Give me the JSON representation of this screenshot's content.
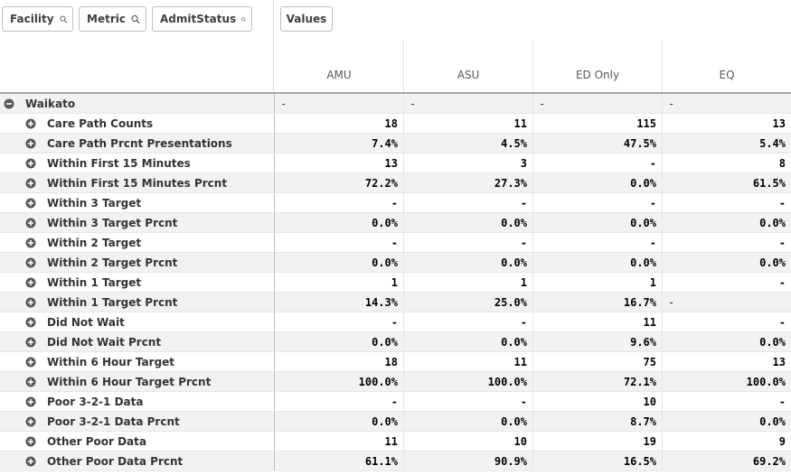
{
  "filters": [
    {
      "label": "Facility",
      "icon": "search-icon"
    },
    {
      "label": "Metric",
      "icon": "search-icon"
    },
    {
      "label": "AdmitStatus",
      "icon": "search-icon"
    }
  ],
  "values_chip": {
    "label": "Values"
  },
  "columns": [
    "AMU",
    "ASU",
    "ED Only",
    "EQ"
  ],
  "group": {
    "label": "Waikato",
    "icon": "collapse-minus-icon",
    "cells": [
      "-",
      "-",
      "-",
      "-"
    ]
  },
  "rows": [
    {
      "label": "Care Path Counts",
      "cells": [
        "18",
        "11",
        "115",
        "13"
      ]
    },
    {
      "label": "Care Path Prcnt Presentations",
      "cells": [
        "7.4%",
        "4.5%",
        "47.5%",
        "5.4%"
      ]
    },
    {
      "label": "Within First 15 Minutes",
      "cells": [
        "13",
        "3",
        "-",
        "8"
      ]
    },
    {
      "label": "Within First 15 Minutes Prcnt",
      "cells": [
        "72.2%",
        "27.3%",
        "0.0%",
        "61.5%"
      ]
    },
    {
      "label": "Within 3 Target",
      "cells": [
        "-",
        "-",
        "-",
        "-"
      ]
    },
    {
      "label": "Within 3 Target Prcnt",
      "cells": [
        "0.0%",
        "0.0%",
        "0.0%",
        "0.0%"
      ]
    },
    {
      "label": "Within 2 Target",
      "cells": [
        "-",
        "-",
        "-",
        "-"
      ]
    },
    {
      "label": "Within 2 Target Prcnt",
      "cells": [
        "0.0%",
        "0.0%",
        "0.0%",
        "0.0%"
      ]
    },
    {
      "label": "Within 1 Target",
      "cells": [
        "1",
        "1",
        "1",
        "-"
      ]
    },
    {
      "label": "Within 1 Target Prcnt",
      "cells": [
        "14.3%",
        "25.0%",
        "16.7%",
        "-"
      ]
    },
    {
      "label": "Did Not Wait",
      "cells": [
        "-",
        "-",
        "11",
        "-"
      ]
    },
    {
      "label": "Did Not Wait Prcnt",
      "cells": [
        "0.0%",
        "0.0%",
        "9.6%",
        "0.0%"
      ]
    },
    {
      "label": "Within 6 Hour Target",
      "cells": [
        "18",
        "11",
        "75",
        "13"
      ]
    },
    {
      "label": "Within 6 Hour Target Prcnt",
      "cells": [
        "100.0%",
        "100.0%",
        "72.1%",
        "100.0%"
      ]
    },
    {
      "label": "Poor 3-2-1 Data",
      "cells": [
        "-",
        "-",
        "10",
        "-"
      ]
    },
    {
      "label": "Poor 3-2-1 Data Prcnt",
      "cells": [
        "0.0%",
        "0.0%",
        "8.7%",
        "0.0%"
      ]
    },
    {
      "label": "Other Poor Data",
      "cells": [
        "11",
        "10",
        "19",
        "9"
      ]
    },
    {
      "label": "Other Poor Data Prcnt",
      "cells": [
        "61.1%",
        "90.9%",
        "16.5%",
        "69.2%"
      ]
    }
  ],
  "left_aligned_cells": [
    [
      9,
      3
    ]
  ],
  "colors": {
    "alt_row": "#f2f2f2",
    "toggle": "#595959"
  }
}
